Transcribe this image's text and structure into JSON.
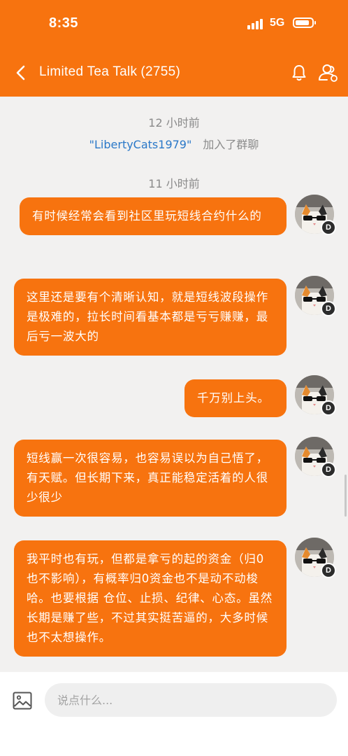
{
  "status_bar": {
    "time": "8:35",
    "network": "5G",
    "battery_level": 0.85
  },
  "header": {
    "title": "Limited Tea Talk",
    "member_count": "(2755)"
  },
  "system_messages": [
    {
      "timestamp": "12 小时前"
    },
    {
      "user": "\"LibertyCats1979\"",
      "action": "加入了群聊"
    },
    {
      "timestamp": "11 小时前"
    }
  ],
  "messages": [
    {
      "text": "有时候经常会看到社区里玩短线合约什么的",
      "badge": "D"
    },
    {
      "text": "这里还是要有个清晰认知，就是短线波段操作是极难的，拉长时间看基本都是亏亏赚赚，最后亏一波大的",
      "badge": "D"
    },
    {
      "text": "千万别上头。",
      "badge": "D"
    },
    {
      "text": "短线赢一次很容易，也容易误以为自己悟了，有天赋。但长期下来，真正能稳定活着的人很少很少",
      "badge": "D"
    },
    {
      "text": "我平时也有玩，但都是拿亏的起的资金（归0也不影响），有概率归0资金也不是动不动梭哈。也要根据 仓位、止损、纪律、心态。虽然长期是赚了些，不过其实挺苦逼的，大多时候也不太想操作。",
      "badge": "D"
    }
  ],
  "composer": {
    "placeholder": "说点什么..."
  },
  "colors": {
    "accent": "#f7730f",
    "link": "#2a78c8",
    "background": "#f2f1f0"
  },
  "icons": [
    "back-arrow-icon",
    "bell-icon",
    "members-icon",
    "image-icon"
  ]
}
